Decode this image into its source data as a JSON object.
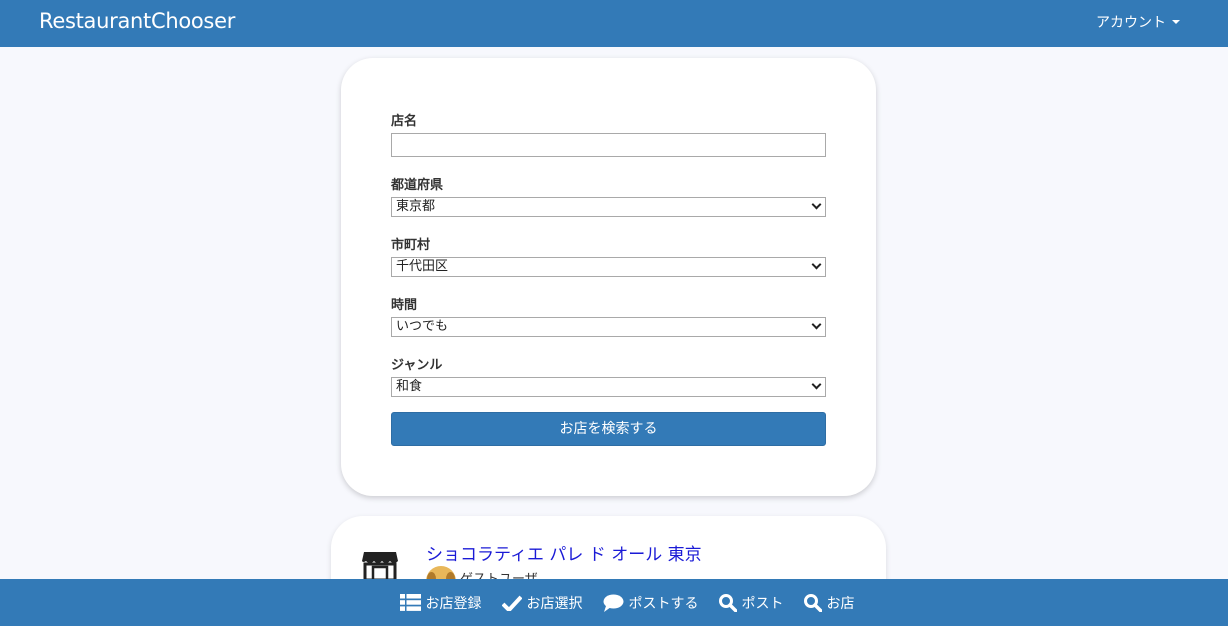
{
  "navbar": {
    "brand": "RestaurantChooser",
    "account_label": "アカウント"
  },
  "form": {
    "name_label": "店名",
    "name_value": "",
    "prefecture_label": "都道府県",
    "prefecture_value": "東京都",
    "city_label": "市町村",
    "city_value": "千代田区",
    "time_label": "時間",
    "time_value": "いつでも",
    "genre_label": "ジャンル",
    "genre_value": "和食",
    "submit_label": "お店を検索する"
  },
  "result": {
    "title": "ショコラティエ パレ ド オール 東京",
    "user": "ゲストユーザ"
  },
  "bottom_nav": {
    "items": [
      {
        "label": "お店登録",
        "icon": "list-icon"
      },
      {
        "label": "お店選択",
        "icon": "check-icon"
      },
      {
        "label": "ポストする",
        "icon": "comment-icon"
      },
      {
        "label": "ポスト",
        "icon": "search-icon"
      },
      {
        "label": "お店",
        "icon": "search-icon"
      }
    ]
  },
  "colors": {
    "primary": "#337ab7",
    "background": "#f7f8fd",
    "link": "#1a1ad6"
  }
}
